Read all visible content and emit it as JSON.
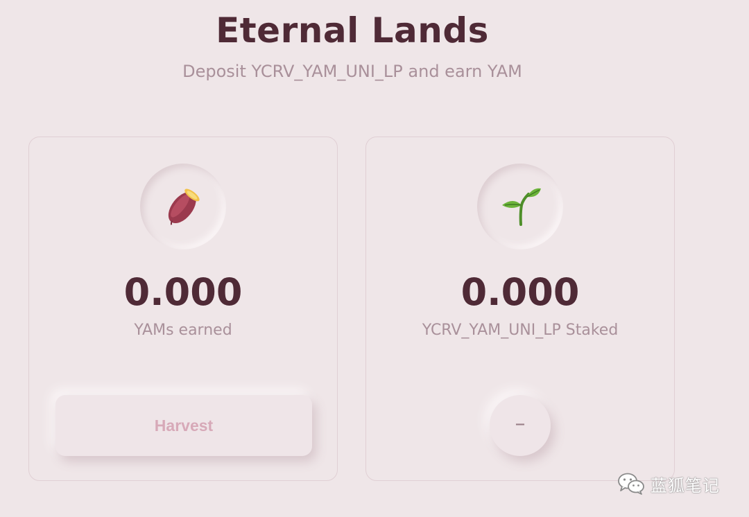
{
  "header": {
    "title": "Eternal Lands",
    "subtitle": "Deposit YCRV_YAM_UNI_LP and earn YAM"
  },
  "cards": [
    {
      "icon": "sweet-potato-icon",
      "value": "0.000",
      "label": "YAMs earned",
      "action_label": "Harvest"
    },
    {
      "icon": "seedling-icon",
      "value": "0.000",
      "label": "YCRV_YAM_UNI_LP Staked",
      "action_label": "–"
    }
  ],
  "watermark": {
    "icon": "wechat-icon",
    "text": "蓝狐笔记"
  },
  "colors": {
    "background": "#efe6e8",
    "title": "#4f2a36",
    "muted": "#a9909a",
    "harvest_text": "#d7a9b8"
  }
}
